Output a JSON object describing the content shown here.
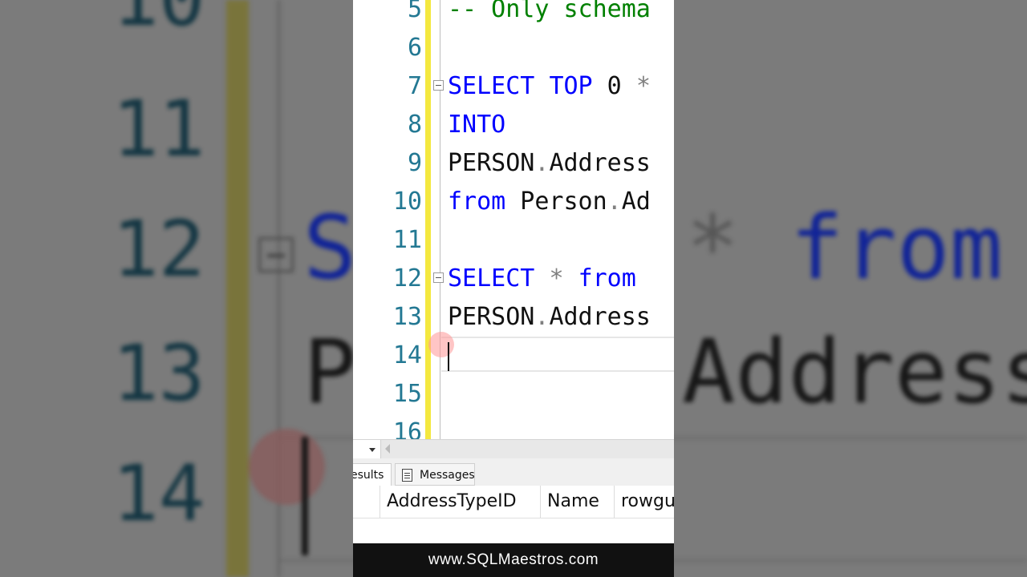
{
  "editor": {
    "lines": [
      {
        "num": "5",
        "tokens": [
          {
            "t": "-- Only schema",
            "c": "cm"
          }
        ]
      },
      {
        "num": "6",
        "tokens": []
      },
      {
        "num": "7",
        "tokens": [
          {
            "t": "SELECT",
            "c": "kw"
          },
          {
            "t": " ",
            "c": ""
          },
          {
            "t": "TOP",
            "c": "kw"
          },
          {
            "t": " 0 ",
            "c": ""
          },
          {
            "t": "*",
            "c": "op"
          }
        ]
      },
      {
        "num": "8",
        "tokens": [
          {
            "t": "INTO",
            "c": "kw"
          }
        ]
      },
      {
        "num": "9",
        "tokens": [
          {
            "t": "PERSON",
            "c": ""
          },
          {
            "t": ".",
            "c": "op"
          },
          {
            "t": "Address",
            "c": ""
          }
        ]
      },
      {
        "num": "10",
        "tokens": [
          {
            "t": "from",
            "c": "kw"
          },
          {
            "t": " Person",
            "c": ""
          },
          {
            "t": ".",
            "c": "op"
          },
          {
            "t": "Ad",
            "c": ""
          }
        ]
      },
      {
        "num": "11",
        "tokens": []
      },
      {
        "num": "12",
        "tokens": [
          {
            "t": "SELECT",
            "c": "kw"
          },
          {
            "t": " ",
            "c": ""
          },
          {
            "t": "*",
            "c": "op"
          },
          {
            "t": " ",
            "c": ""
          },
          {
            "t": "from",
            "c": "kw"
          }
        ]
      },
      {
        "num": "13",
        "tokens": [
          {
            "t": "PERSON",
            "c": ""
          },
          {
            "t": ".",
            "c": "op"
          },
          {
            "t": "Address",
            "c": ""
          }
        ]
      },
      {
        "num": "14",
        "tokens": []
      },
      {
        "num": "15",
        "tokens": []
      },
      {
        "num": "16",
        "tokens": []
      }
    ]
  },
  "background": {
    "numbers": [
      "10",
      "11",
      "12",
      "13",
      "14"
    ],
    "code_12a": "S",
    "code_12b": "* ",
    "code_12c": "from",
    "code_13a": "P",
    "code_13b": "Address"
  },
  "tabs": {
    "results": "esults",
    "messages": "Messages"
  },
  "grid": {
    "columns": [
      "AddressTypeID",
      "Name",
      "rowgu"
    ]
  },
  "footer": {
    "text": "www.SQLMaestros.com"
  },
  "colors": {
    "keyword": "#0000ff",
    "comment": "#008000",
    "line_number": "#237893",
    "change_marker": "#f4e83f"
  }
}
